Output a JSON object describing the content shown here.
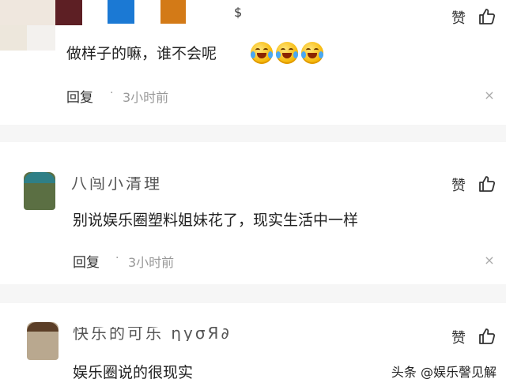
{
  "comments": [
    {
      "username": "$",
      "text": "做样子的嘛，谁不会呢",
      "emoji_count": 3,
      "reply_label": "回复",
      "time": "3小时前",
      "like_label": "赞"
    },
    {
      "username": "八闯小清理",
      "text": "别说娱乐圈塑料姐妹花了，现实生活中一样",
      "reply_label": "回复",
      "time": "3小时前",
      "like_label": "赞"
    },
    {
      "username": "快乐的可乐 ηyσЯ∂",
      "text": "娱乐圈说的很现实",
      "like_label": "赞"
    }
  ],
  "icons": {
    "like": "thumbs-up-icon",
    "close": "close-icon",
    "emoji": "laughing-crying-emoji-icon"
  },
  "separator": "·",
  "close_glyph": "×",
  "watermark": "头条 @娱乐謦见解"
}
